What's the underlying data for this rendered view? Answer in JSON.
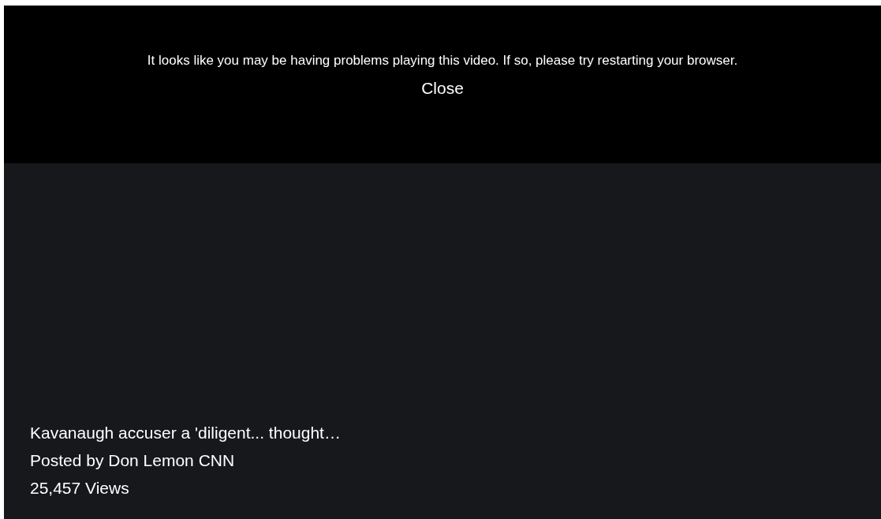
{
  "error_banner": {
    "message": "It looks like you may be having problems playing this video. If so, please try restarting your browser.",
    "close_label": "Close"
  },
  "video": {
    "title": "Kavanaugh accuser a 'diligent... thought…",
    "posted_by": "Posted by Don Lemon CNN",
    "views": "25,457 Views"
  }
}
